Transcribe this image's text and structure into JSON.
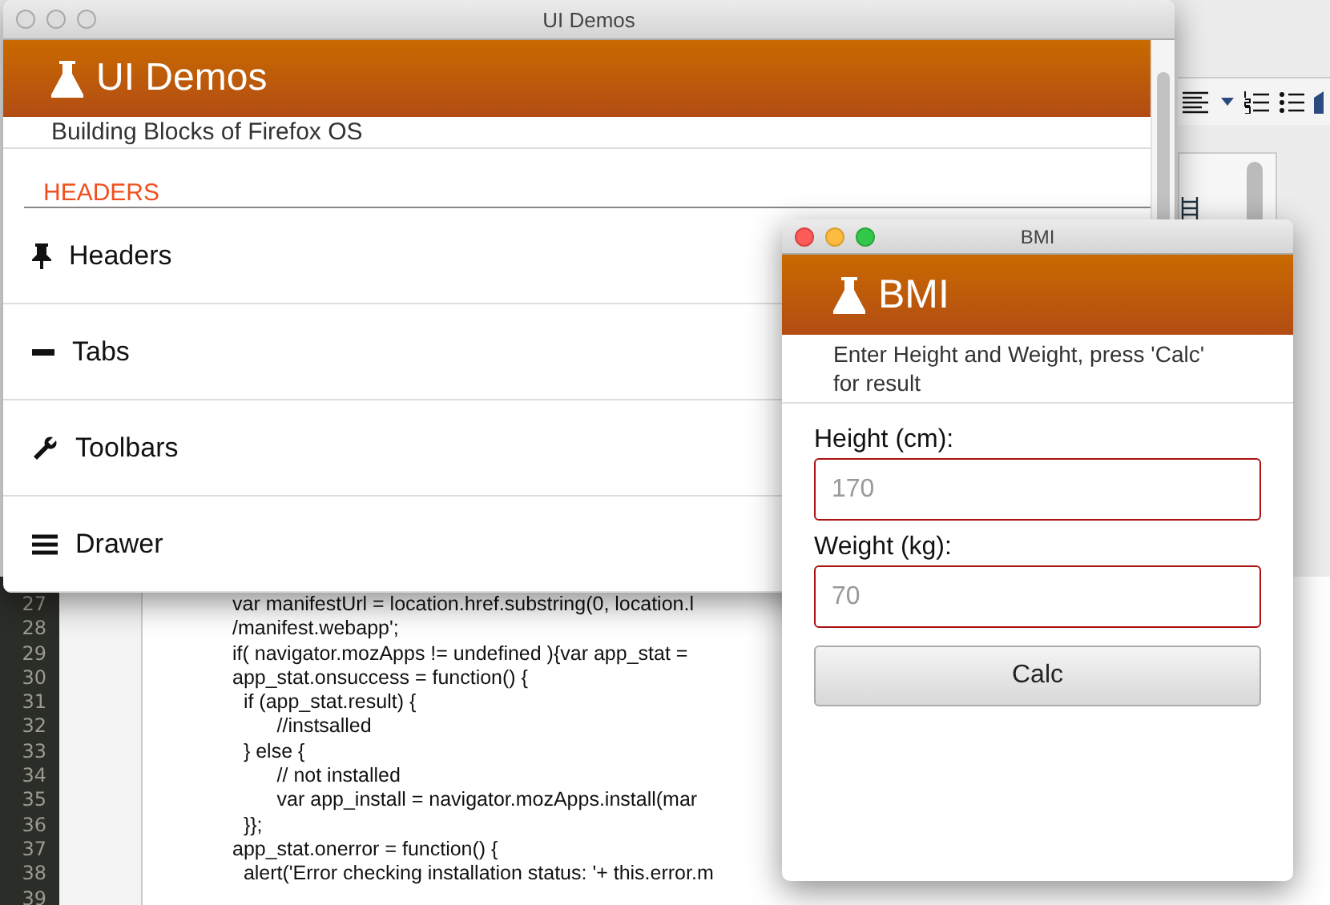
{
  "demo_window": {
    "title": "UI Demos",
    "header": "UI Demos",
    "subtitle": "Building Blocks of Firefox OS",
    "section": "HEADERS",
    "items": [
      {
        "kind": "pin",
        "label": "Headers"
      },
      {
        "kind": "minus",
        "label": "Tabs"
      },
      {
        "kind": "wrench",
        "label": "Toolbars"
      },
      {
        "kind": "menu",
        "label": "Drawer"
      }
    ]
  },
  "editor": {
    "lines": [
      {
        "number": "27",
        "code": "var manifestUrl = location.href.substring(0, location.l"
      },
      {
        "number": "28",
        "code": "/manifest.webapp';"
      },
      {
        "number": "29",
        "code": "if( navigator.mozApps != undefined ){var app_stat ="
      },
      {
        "number": "30",
        "code": "app_stat.onsuccess = function() {"
      },
      {
        "number": "31",
        "code": "  if (app_stat.result) {"
      },
      {
        "number": "32",
        "code": "        //instsalled"
      },
      {
        "number": "33",
        "code": "  } else {"
      },
      {
        "number": "34",
        "code": "        // not installed"
      },
      {
        "number": "35",
        "code": "        var app_install = navigator.mozApps.install(mar"
      },
      {
        "number": "36",
        "code": "  }};"
      },
      {
        "number": "37",
        "code": "app_stat.onerror = function() {"
      },
      {
        "number": "38",
        "code": "  alert('Error checking installation status: '+ this.error.m"
      },
      {
        "number": "39"
      }
    ]
  },
  "bmi_window": {
    "title": "BMI",
    "header": "BMI",
    "instructions": "Enter Height and Weight, press 'Calc' for result",
    "fields": [
      {
        "label": "Height (cm):",
        "placeholder": "170"
      },
      {
        "label": "Weight (kg):",
        "placeholder": "70"
      }
    ],
    "button": "Calc"
  }
}
